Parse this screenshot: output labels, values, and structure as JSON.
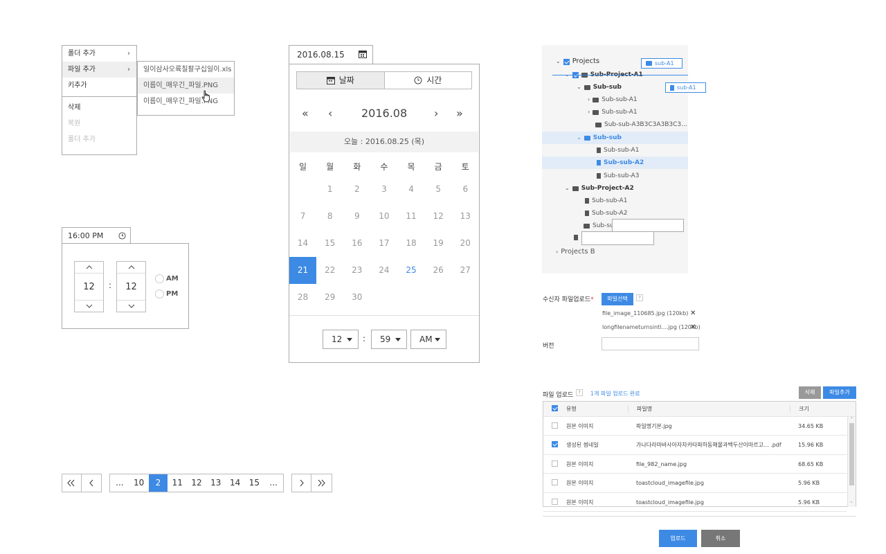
{
  "context_menu": {
    "items": [
      {
        "label": "폴더 추가",
        "sub": true
      },
      {
        "label": "파일 추가",
        "sub": true
      },
      {
        "label": "키추가"
      },
      {
        "label": "삭제"
      },
      {
        "label": "복원"
      },
      {
        "label": "폴더 추가"
      }
    ],
    "submenu": [
      "일이삼사오륙칠팔구십일이.xls",
      "이름이_매우긴_파일.PNG",
      "이름이_매우긴_파일.PNG"
    ]
  },
  "datepicker": {
    "input_value": "2016.08.15",
    "tab_date": "날짜",
    "tab_time": "시간",
    "nav": {
      "prev_year": "«",
      "prev_month": "‹",
      "next_month": "›",
      "next_year": "»"
    },
    "month": "2016.08",
    "today_label": "오늘 : 2016.08.25 (목)",
    "weekdays": [
      "일",
      "월",
      "화",
      "수",
      "목",
      "금",
      "토"
    ],
    "weeks": [
      [
        "",
        "1",
        "2",
        "3",
        "4",
        "5",
        "6"
      ],
      [
        "7",
        "8",
        "9",
        "10",
        "11",
        "12",
        "13"
      ],
      [
        "14",
        "15",
        "16",
        "17",
        "18",
        "19",
        "20"
      ],
      [
        "21",
        "22",
        "23",
        "24",
        "25",
        "26",
        "27"
      ],
      [
        "28",
        "29",
        "30",
        "",
        "",
        "",
        ""
      ]
    ],
    "selected_day": "21",
    "today_day": "25",
    "hour": "12",
    "colon": ":",
    "minute": "59",
    "ampm": "AM"
  },
  "timepicker": {
    "input_value": "16:00 PM",
    "hour": "12",
    "minute": "12",
    "colon": ":",
    "am": "AM",
    "pm": "PM"
  },
  "pagination": {
    "pages": [
      "...",
      "10",
      "2",
      "11",
      "12",
      "13",
      "14",
      "15",
      "..."
    ],
    "active": "2"
  },
  "tree": {
    "nodes": [
      {
        "label": "Projects"
      },
      {
        "label": "Sub-Project-A1"
      },
      {
        "label": "Sub-sub"
      },
      {
        "label": "Sub-sub-A1"
      },
      {
        "label": "Sub-sub-A1"
      },
      {
        "label": "Sub-sub-A3B3C3A3B3C3..."
      },
      {
        "label": "Sub-sub"
      },
      {
        "label": "Sub-sub-A1"
      },
      {
        "label": "Sub-sub-A2"
      },
      {
        "label": "Sub-sub-A3"
      },
      {
        "label": "Sub-Project-A2"
      },
      {
        "label": "Sub-sub-A1"
      },
      {
        "label": "Sub-sub-A2"
      },
      {
        "label": "Sub-sub"
      },
      {
        "label": "Projects B"
      }
    ],
    "drag_labels": [
      "sub-A1",
      "sub-A1"
    ]
  },
  "upload_form": {
    "receiver_label": "수신자 파일업로드",
    "required_mark": "*",
    "select_button": "파일선택",
    "help": "?",
    "files": [
      "file_image_110685.jpg (120kb)",
      "longfilenameturnsintl....jpg (120kb)"
    ],
    "remove": "✕",
    "version_label": "버전"
  },
  "file_upload": {
    "title": "파일 업로드",
    "help": "?",
    "status": "1개 파일 업로드 완료",
    "delete_button": "삭제",
    "add_button": "파일추가",
    "columns": [
      "유형",
      "파일명",
      "크기"
    ],
    "rows": [
      {
        "type": "원본 이미지",
        "name": "파일명기본.jpg",
        "size": "34.65 KB",
        "checked": false
      },
      {
        "type": "생성된 썸네일",
        "name": "가나다라마바사아자차카타파하동해물과백두산이마르고... .pdf",
        "size": "15.96 KB",
        "checked": true
      },
      {
        "type": "원본 이미지",
        "name": "file_982_name.jpg",
        "size": "68.65 KB",
        "checked": false
      },
      {
        "type": "원본 이미지",
        "name": "toastcloud_imagefile.jpg",
        "size": "5.96 KB",
        "checked": false
      },
      {
        "type": "원본 이미지",
        "name": "toastcloud_imagefile.jpg",
        "size": "5.96 KB",
        "checked": false
      }
    ],
    "upload_button": "업로드",
    "cancel_button": "취소"
  }
}
